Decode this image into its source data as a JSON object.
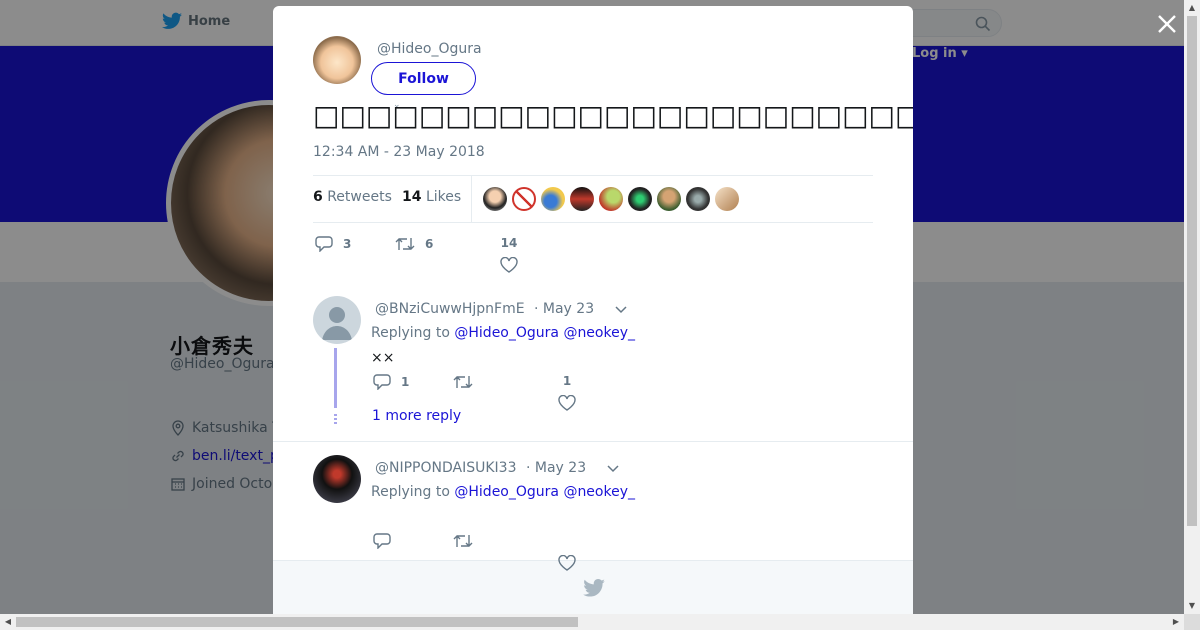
{
  "nav": {
    "home_label": "Home",
    "login_label": "Log in"
  },
  "profile": {
    "name": "小倉秀夫",
    "handle": "@Hideo_Ogura",
    "location": "Katsushika T",
    "link": "ben.li/text_p",
    "joined": "Joined Octo"
  },
  "tweet": {
    "author_handle": "@Hideo_Ogura",
    "follow_label": "Follow",
    "text": "□□□□□□□□□□□□□□□□□□□□□□□□□□□□□□□□□□□□□□□□□□□□□□□□□□□□",
    "timestamp": "12:34 AM - 23 May 2018",
    "retweets_count": "6",
    "retweets_label": "Retweets",
    "likes_count": "14",
    "likes_label": "Likes",
    "actions": {
      "reply": "3",
      "retweet": "6",
      "like": "14"
    }
  },
  "replies": [
    {
      "handle": "@BNziCuwwHjpnFmE",
      "date": "· May 23",
      "replying_prefix": "Replying to",
      "mentions": "@Hideo_Ogura @neokey_",
      "text": "××",
      "reply_count": "1",
      "like_count": "1",
      "more_label": "1 more reply"
    },
    {
      "handle": "@NIPPONDAISUKI33",
      "date": "· May 23",
      "replying_prefix": "Replying to",
      "mentions": "@Hideo_Ogura @neokey_",
      "text": ""
    }
  ],
  "colors": {
    "accent": "#1b14d6",
    "thread": "#a7a5ec",
    "banner": "#1b14d6"
  }
}
